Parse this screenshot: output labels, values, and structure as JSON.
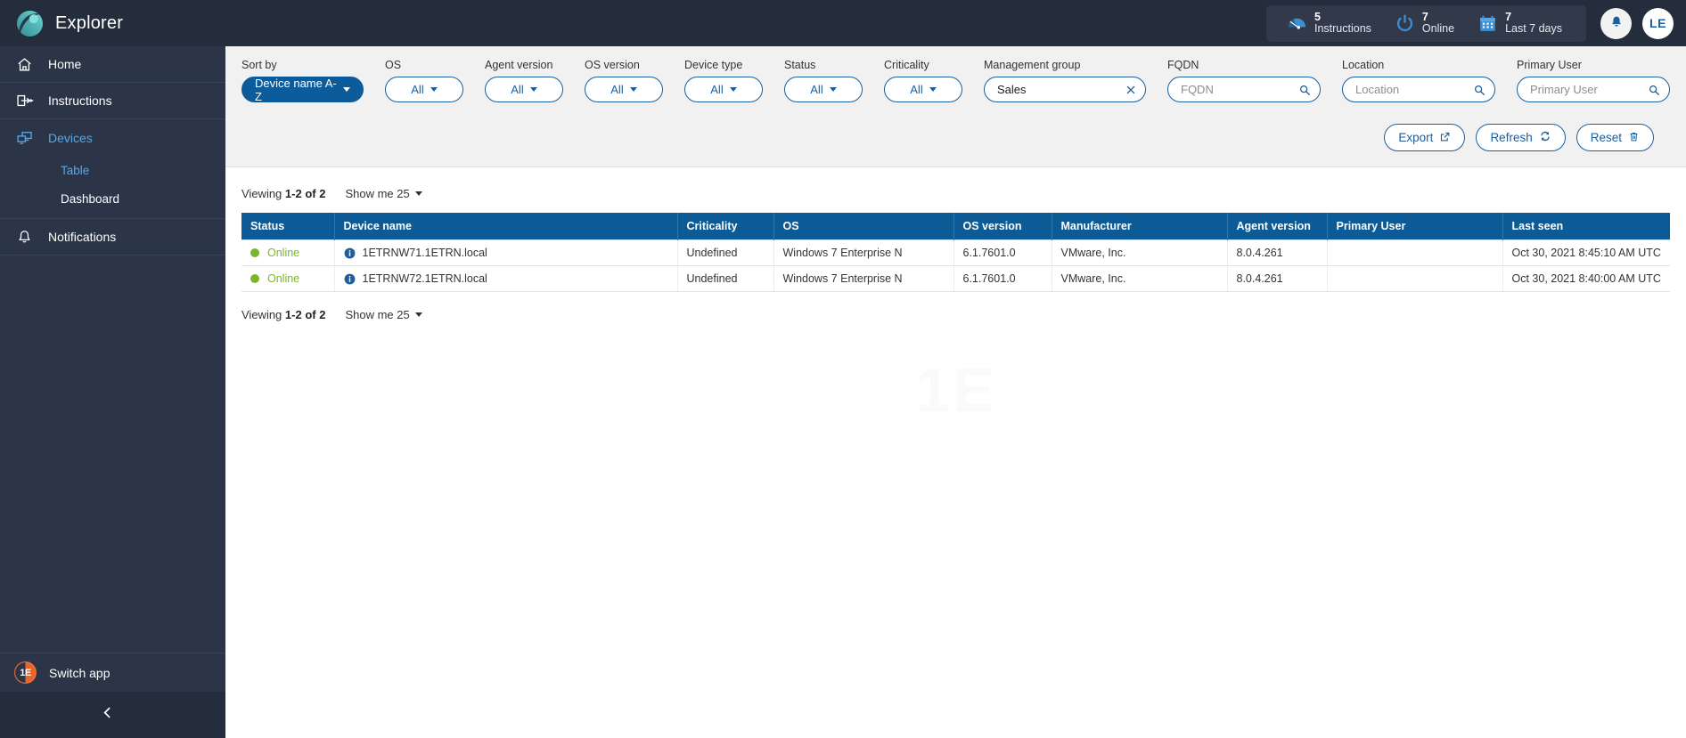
{
  "app": {
    "brand_name": "Explorer",
    "logo_icon": "swoosh-circle-logo",
    "accent_blue": "#0d5b96",
    "header_bg": "#242d3c",
    "sidebar_bg": "#2b3547",
    "status_green": "#7cb52a",
    "link_blue": "#5ba7e8",
    "watermark": "1E"
  },
  "header": {
    "kpis": [
      {
        "value": "5",
        "label": "Instructions",
        "icon": "gauge-icon"
      },
      {
        "value": "7",
        "label": "Online",
        "icon": "power-icon"
      },
      {
        "value": "7",
        "label": "Last 7 days",
        "icon": "calendar-icon"
      }
    ],
    "notifications_icon": "bell-icon",
    "avatar_initials": "LE"
  },
  "sidebar": {
    "items": [
      {
        "label": "Home",
        "icon": "home-icon",
        "active": false
      },
      {
        "label": "Instructions",
        "icon": "instruction-hand-icon",
        "active": false
      },
      {
        "label": "Devices",
        "icon": "devices-monitor-icon",
        "active": true
      },
      {
        "label": "Notifications",
        "icon": "bell-icon",
        "active": false
      }
    ],
    "devices_subitems": [
      {
        "label": "Table",
        "active": true
      },
      {
        "label": "Dashboard",
        "active": false
      }
    ],
    "switch_app": {
      "label": "Switch app",
      "icon": "one-e-logo-icon"
    },
    "collapse_icon": "chevron-left-icon"
  },
  "filters": {
    "sort_by": {
      "label": "Sort by",
      "value": "Device name A-Z",
      "type": "dropdown-primary"
    },
    "dropdowns": [
      {
        "label": "OS",
        "value": "All"
      },
      {
        "label": "Agent version",
        "value": "All"
      },
      {
        "label": "OS version",
        "value": "All"
      },
      {
        "label": "Device type",
        "value": "All"
      },
      {
        "label": "Status",
        "value": "All"
      },
      {
        "label": "Criticality",
        "value": "All"
      }
    ],
    "management_group": {
      "label": "Management group",
      "value": "Sales",
      "placeholder": "Management group",
      "clear_icon": "close-x-icon"
    },
    "fqdn": {
      "label": "FQDN",
      "value": "",
      "placeholder": "FQDN",
      "search_icon": "search-icon"
    },
    "location": {
      "label": "Location",
      "value": "",
      "placeholder": "Location",
      "search_icon": "search-icon"
    },
    "primary_user": {
      "label": "Primary User",
      "value": "",
      "placeholder": "Primary User",
      "search_icon": "search-icon"
    }
  },
  "actions": [
    {
      "label": "Export",
      "icon": "external-link-icon"
    },
    {
      "label": "Refresh",
      "icon": "refresh-icon"
    },
    {
      "label": "Reset",
      "icon": "trash-icon"
    }
  ],
  "pagination": {
    "viewing_prefix": "Viewing",
    "viewing_range": "1-2 of 2",
    "show_me_label": "Show me 25"
  },
  "table": {
    "columns": [
      "Status",
      "Device name",
      "Criticality",
      "OS",
      "OS version",
      "Manufacturer",
      "Agent version",
      "Primary User",
      "Last seen"
    ],
    "rows": [
      {
        "status": "Online",
        "device_name": "1ETRNW71.1ETRN.local",
        "criticality": "Undefined",
        "os": "Windows 7 Enterprise N",
        "os_version": "6.1.7601.0",
        "manufacturer": "VMware, Inc.",
        "agent_version": "8.0.4.261",
        "primary_user": "",
        "last_seen": "Oct 30, 2021 8:45:10 AM UTC"
      },
      {
        "status": "Online",
        "device_name": "1ETRNW72.1ETRN.local",
        "criticality": "Undefined",
        "os": "Windows 7 Enterprise N",
        "os_version": "6.1.7601.0",
        "manufacturer": "VMware, Inc.",
        "agent_version": "8.0.4.261",
        "primary_user": "",
        "last_seen": "Oct 30, 2021 8:40:00 AM UTC"
      }
    ]
  }
}
